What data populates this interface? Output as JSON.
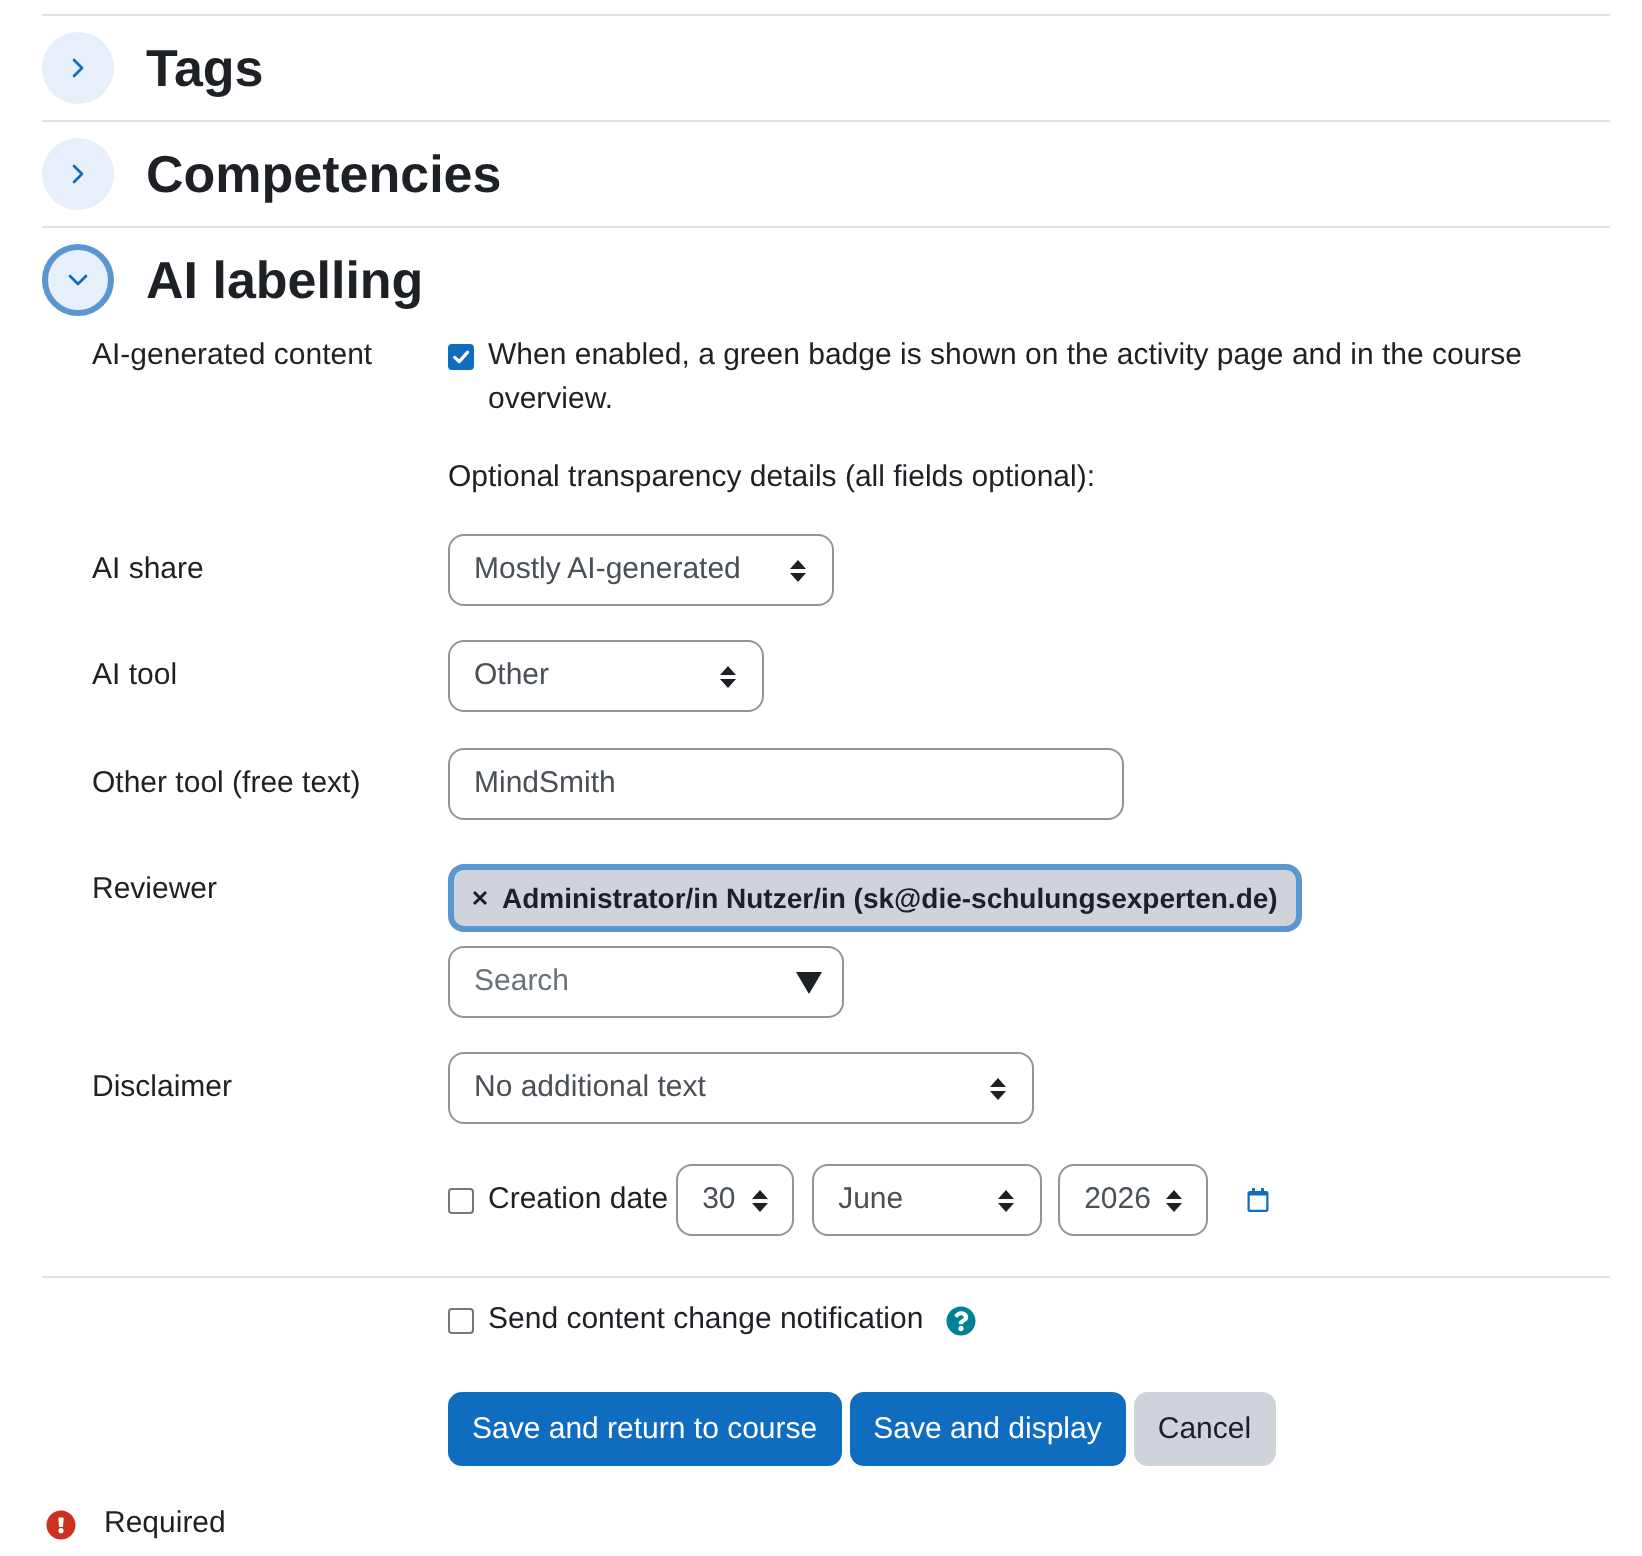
{
  "sections": [
    {
      "title": "Tags",
      "expanded": false,
      "focused": false
    },
    {
      "title": "Competencies",
      "expanded": false,
      "focused": false
    },
    {
      "title": "AI labelling",
      "expanded": true,
      "focused": true,
      "fields": [
        {
          "kind": "checkbox",
          "label": "AI-generated content",
          "checked": true,
          "text": "When enabled, a green badge is shown on the activity page and in the course overview."
        },
        {
          "kind": "note",
          "text": "Optional transparency details (all fields optional):"
        },
        {
          "kind": "select",
          "label": "AI share",
          "value": "Mostly AI-generated"
        },
        {
          "kind": "select",
          "label": "AI tool",
          "value": "Other"
        },
        {
          "kind": "text",
          "label": "Other tool (free text)",
          "value": "MindSmith"
        },
        {
          "kind": "autocomplete",
          "label": "Reviewer",
          "chips": [
            {
              "label": "Administrator/in Nutzer/in (sk@die-schulungsexperten.de)",
              "focused": true
            }
          ],
          "placeholder": "Search"
        },
        {
          "kind": "select",
          "label": "Disclaimer",
          "value": "No additional text"
        },
        {
          "kind": "date",
          "label": "Creation date",
          "checked": false,
          "day": "30",
          "month": "June",
          "year": "2026"
        }
      ]
    }
  ],
  "notification": {
    "label": "Send content change notification",
    "checked": false
  },
  "buttons": [
    {
      "label": "Save and return to course",
      "kind": "primary"
    },
    {
      "label": "Save and display",
      "kind": "primary"
    },
    {
      "label": "Cancel",
      "kind": "secondary"
    }
  ],
  "legend": {
    "text": "Required"
  }
}
